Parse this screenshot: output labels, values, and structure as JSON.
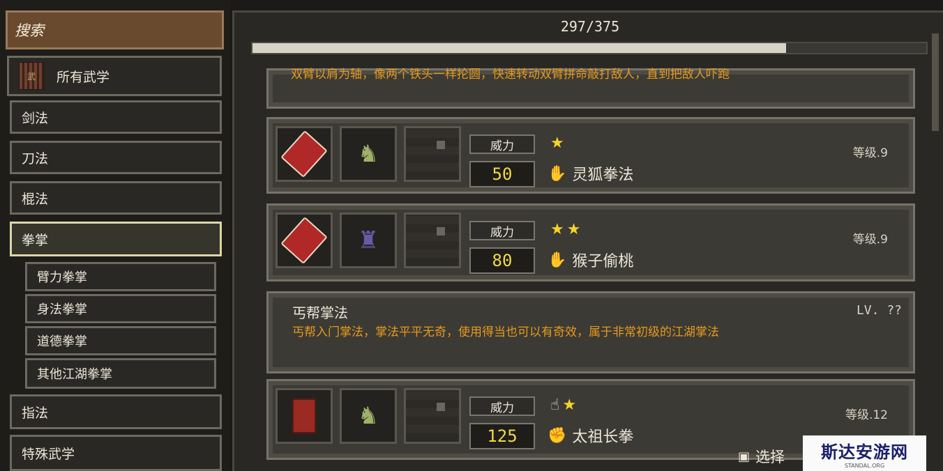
{
  "sidebar": {
    "search_label": "搜索",
    "all_martial": {
      "label": "所有武学",
      "icon_text": "武"
    },
    "categories": [
      "剑法",
      "刀法",
      "棍法",
      "拳掌"
    ],
    "subcategories": [
      "臂力拳掌",
      "身法拳掌",
      "道德拳掌",
      "其他江湖拳掌"
    ],
    "more_categories": [
      "指法",
      "特殊武学"
    ]
  },
  "progress": {
    "text": "297/375",
    "value": 297,
    "max": 375
  },
  "cards": {
    "partial": {
      "desc": "双臂以肩为轴，像两个铁头一样抡圆，快速转动双臂拼命敲打敌人，直到把敌人吓跑"
    },
    "items": [
      {
        "power_label": "威力",
        "power": "50",
        "stars": "★",
        "name": "灵狐拳法",
        "level": "等级.9",
        "name_icon": "palm-icon",
        "book": "open-book"
      },
      {
        "power_label": "威力",
        "power": "80",
        "stars": "★★",
        "name": "猴子偷桃",
        "level": "等级.9",
        "name_icon": "palm-icon",
        "book": "open-book"
      },
      {
        "power_label": "威力",
        "power": "125",
        "stars": "★",
        "name": "太祖长拳",
        "level": "等级.12",
        "name_icon": "fist-icon",
        "book": "closed-book"
      }
    ],
    "detail": {
      "title": "丐帮掌法",
      "level": "LV. ??",
      "desc": "丐帮入门掌法，掌法平平无奇，使用得当也可以有奇效，属于非常初级的江湖掌法"
    }
  },
  "footer": {
    "select_label": "选择"
  },
  "watermark": {
    "title": "斯达安游网",
    "sub": "STANDAL.ORG"
  },
  "colors": {
    "accent_orange": "#e59a1c",
    "star": "#f5d428",
    "value_yellow": "#f2d84a",
    "search_bg": "#6a4a2e"
  }
}
